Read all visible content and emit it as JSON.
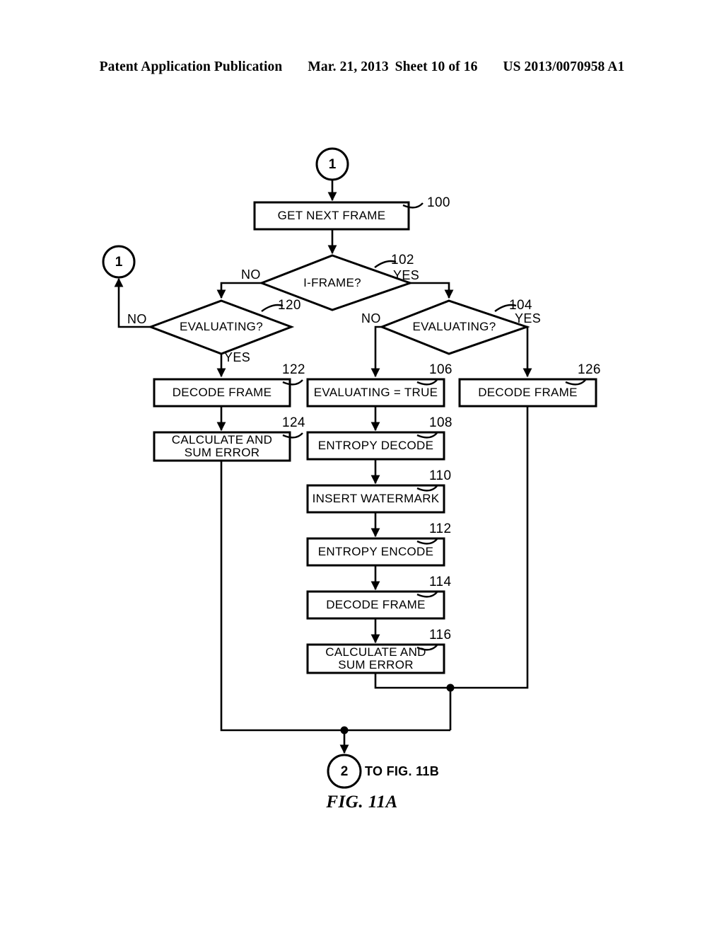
{
  "header": {
    "publication": "Patent Application Publication",
    "date": "Mar. 21, 2013",
    "sheet": "Sheet 10 of 16",
    "patent_number": "US 2013/0070958 A1"
  },
  "figure": {
    "caption": "FIG. 11A"
  },
  "connectors": {
    "entry": {
      "label": "1"
    },
    "loop_back": {
      "label": "1"
    },
    "exit": {
      "label": "2",
      "text": "TO FIG. 11B"
    }
  },
  "nodes": {
    "get_next_frame": {
      "label": "GET NEXT FRAME",
      "ref": "100"
    },
    "i_frame": {
      "label": "I-FRAME?",
      "ref": "102",
      "no": "NO",
      "yes": "YES"
    },
    "evaluating_left": {
      "label": "EVALUATING?",
      "ref": "120",
      "no": "NO",
      "yes": "YES"
    },
    "evaluating_right": {
      "label": "EVALUATING?",
      "ref": "104",
      "no": "NO",
      "yes": "YES"
    },
    "decode_frame_left": {
      "label": "DECODE FRAME",
      "ref": "122"
    },
    "calculate_sum_error_left": {
      "label": "CALCULATE AND\nSUM ERROR",
      "ref": "124"
    },
    "evaluating_true": {
      "label": "EVALUATING = TRUE",
      "ref": "106"
    },
    "entropy_decode": {
      "label": "ENTROPY DECODE",
      "ref": "108"
    },
    "insert_watermark": {
      "label": "INSERT WATERMARK",
      "ref": "110"
    },
    "entropy_encode": {
      "label": "ENTROPY ENCODE",
      "ref": "112"
    },
    "decode_frame_mid": {
      "label": "DECODE FRAME",
      "ref": "114"
    },
    "calculate_sum_error_mid": {
      "label": "CALCULATE AND\nSUM ERROR",
      "ref": "116"
    },
    "decode_frame_right": {
      "label": "DECODE FRAME",
      "ref": "126"
    }
  },
  "colors": {
    "ink": "#000000",
    "paper": "#ffffff"
  }
}
